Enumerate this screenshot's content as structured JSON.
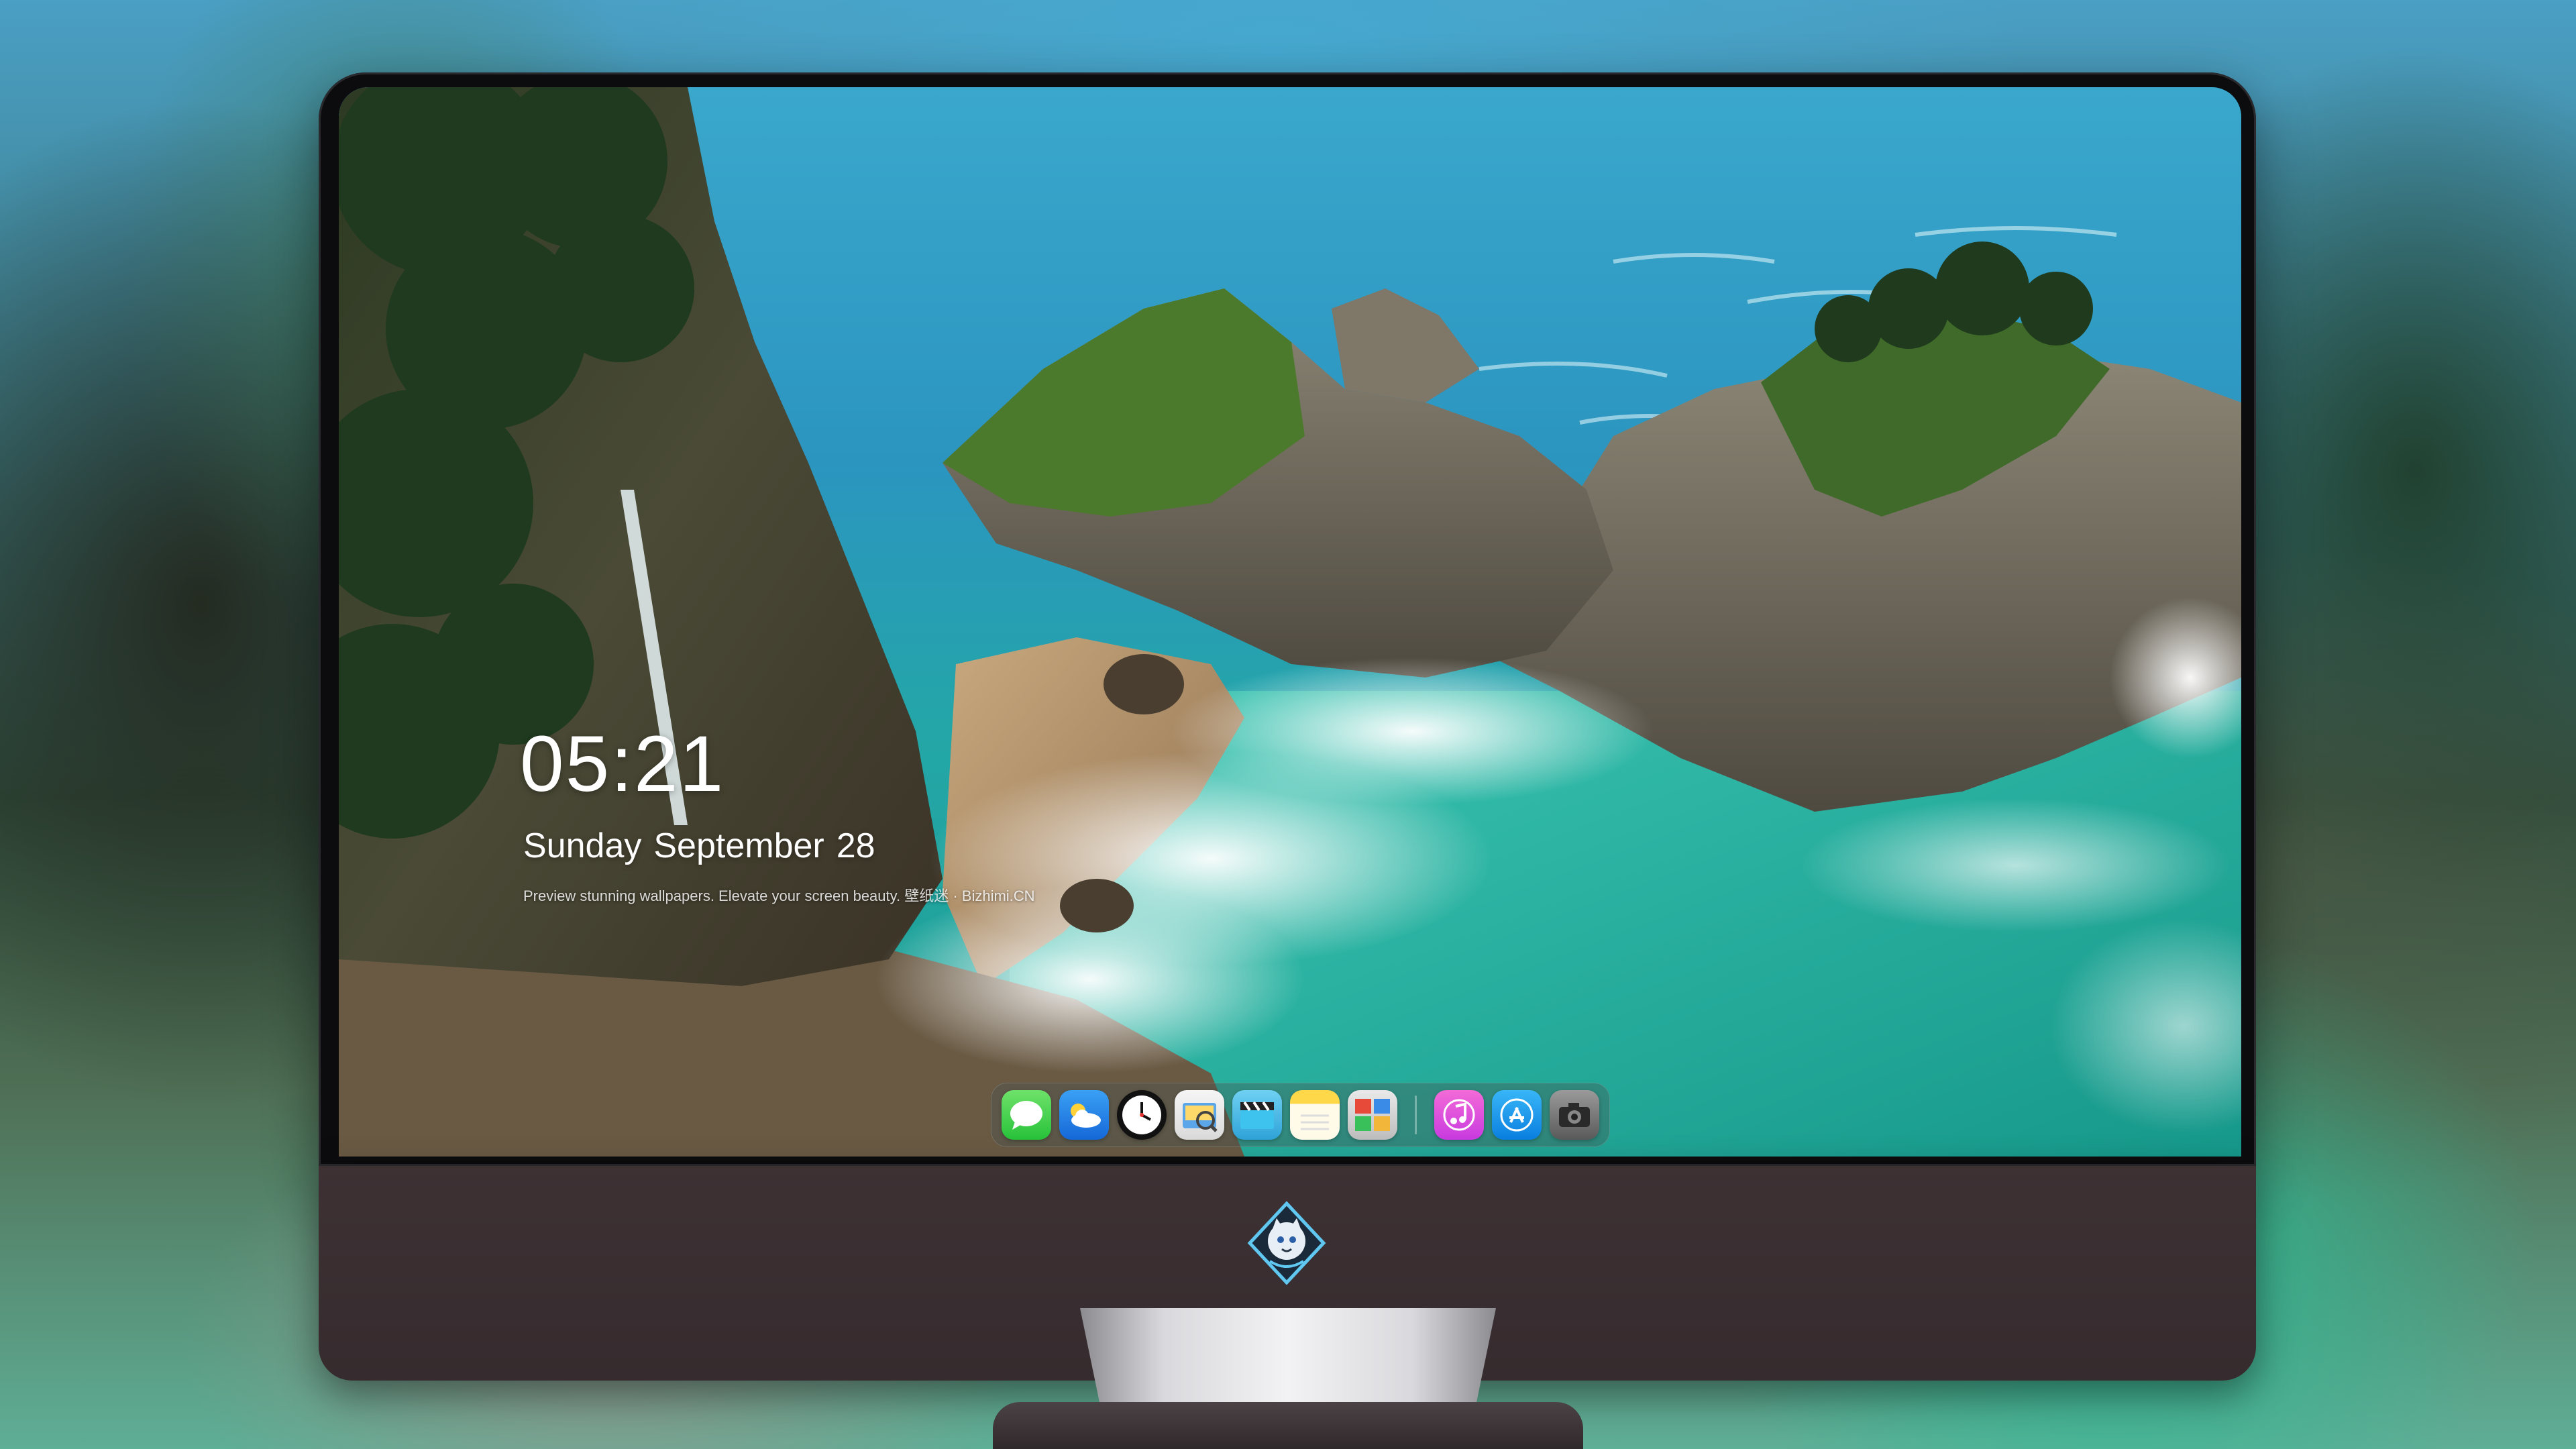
{
  "lock_screen": {
    "time": "05:21",
    "weekday": "Sunday",
    "month": "September",
    "day": "28",
    "tagline": "Preview stunning wallpapers. Elevate your screen beauty. 壁纸迷 · Bizhimi.CN"
  },
  "dock": {
    "items": [
      {
        "name": "messages-icon",
        "label": "Messages"
      },
      {
        "name": "weather-icon",
        "label": "Weather"
      },
      {
        "name": "clock-icon",
        "label": "Clock"
      },
      {
        "name": "preview-icon",
        "label": "Preview"
      },
      {
        "name": "clapper-icon",
        "label": "Videos"
      },
      {
        "name": "notes-icon",
        "label": "Notes"
      },
      {
        "name": "photo-booth-icon",
        "label": "Photo Booth"
      },
      {
        "name": "music-icon",
        "label": "Music"
      },
      {
        "name": "app-store-icon",
        "label": "App Store"
      },
      {
        "name": "camera-icon",
        "label": "Camera"
      }
    ]
  },
  "colors": {
    "bezel": "#0c0c0e",
    "chin": "#3d3134",
    "sea": "#1fa9a2",
    "sky_water": "#2c9ec8"
  }
}
